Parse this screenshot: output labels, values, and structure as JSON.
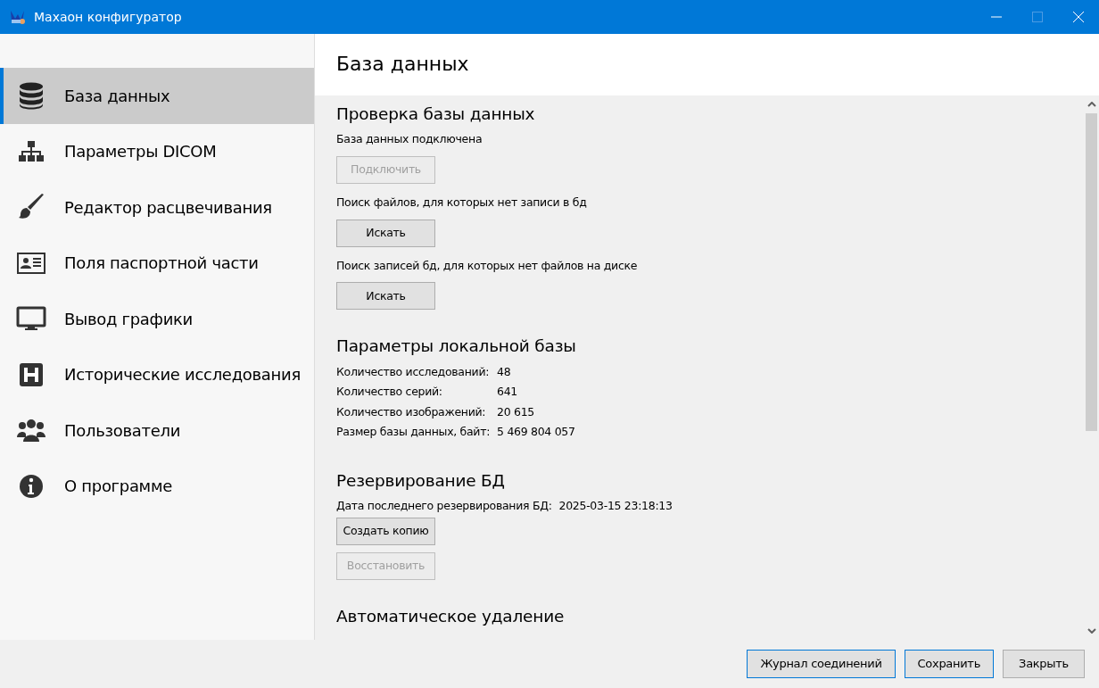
{
  "window": {
    "title": "Махаон конфигуратор",
    "maximize_disabled": true
  },
  "sidebar": {
    "items": [
      {
        "label": "База данных",
        "selected": true
      },
      {
        "label": "Параметры DICOM",
        "selected": false
      },
      {
        "label": "Редактор расцвечивания",
        "selected": false
      },
      {
        "label": "Поля паспортной части",
        "selected": false
      },
      {
        "label": "Вывод графики",
        "selected": false
      },
      {
        "label": "Исторические исследования",
        "selected": false
      },
      {
        "label": "Пользователи",
        "selected": false
      },
      {
        "label": "О программе",
        "selected": false
      }
    ]
  },
  "page_title": "База данных",
  "sections": [
    {
      "title": "Проверка базы данных",
      "items": [
        {
          "kind": "text",
          "text": "База данных подключена"
        },
        {
          "kind": "button",
          "label": "Подключить",
          "disabled": true
        },
        {
          "kind": "text",
          "text": "Поиск файлов, для которых нет записи в бд"
        },
        {
          "kind": "button",
          "label": "Искать",
          "disabled": false
        },
        {
          "kind": "text",
          "text": "Поиск записей бд, для которых нет файлов на диске"
        },
        {
          "kind": "button",
          "label": "Искать",
          "disabled": false
        }
      ]
    },
    {
      "title": "Параметры локальной базы",
      "items": [
        {
          "kind": "stat",
          "label": "Количество исследований:",
          "value": "48"
        },
        {
          "kind": "stat",
          "label": "Количество серий:",
          "value": "641"
        },
        {
          "kind": "stat",
          "label": "Количество изображений:",
          "value": "20 615"
        },
        {
          "kind": "stat",
          "label": "Размер базы данных, байт:",
          "value": "5 469 804 057"
        }
      ]
    },
    {
      "title": "Резервирование БД",
      "items": [
        {
          "kind": "stat",
          "label": "Дата последнего резервирования БД:",
          "value": "2025-03-15 23:18:13"
        },
        {
          "kind": "button",
          "label": "Создать копию",
          "disabled": false
        },
        {
          "kind": "button",
          "label": "Восстановить",
          "disabled": true
        }
      ]
    },
    {
      "title": "Автоматическое удаление"
    }
  ],
  "footer_buttons": [
    {
      "label": "Журнал соединений",
      "highlighted": true
    },
    {
      "label": "Сохранить",
      "highlighted": true
    },
    {
      "label": "Закрыть",
      "highlighted": false
    }
  ]
}
